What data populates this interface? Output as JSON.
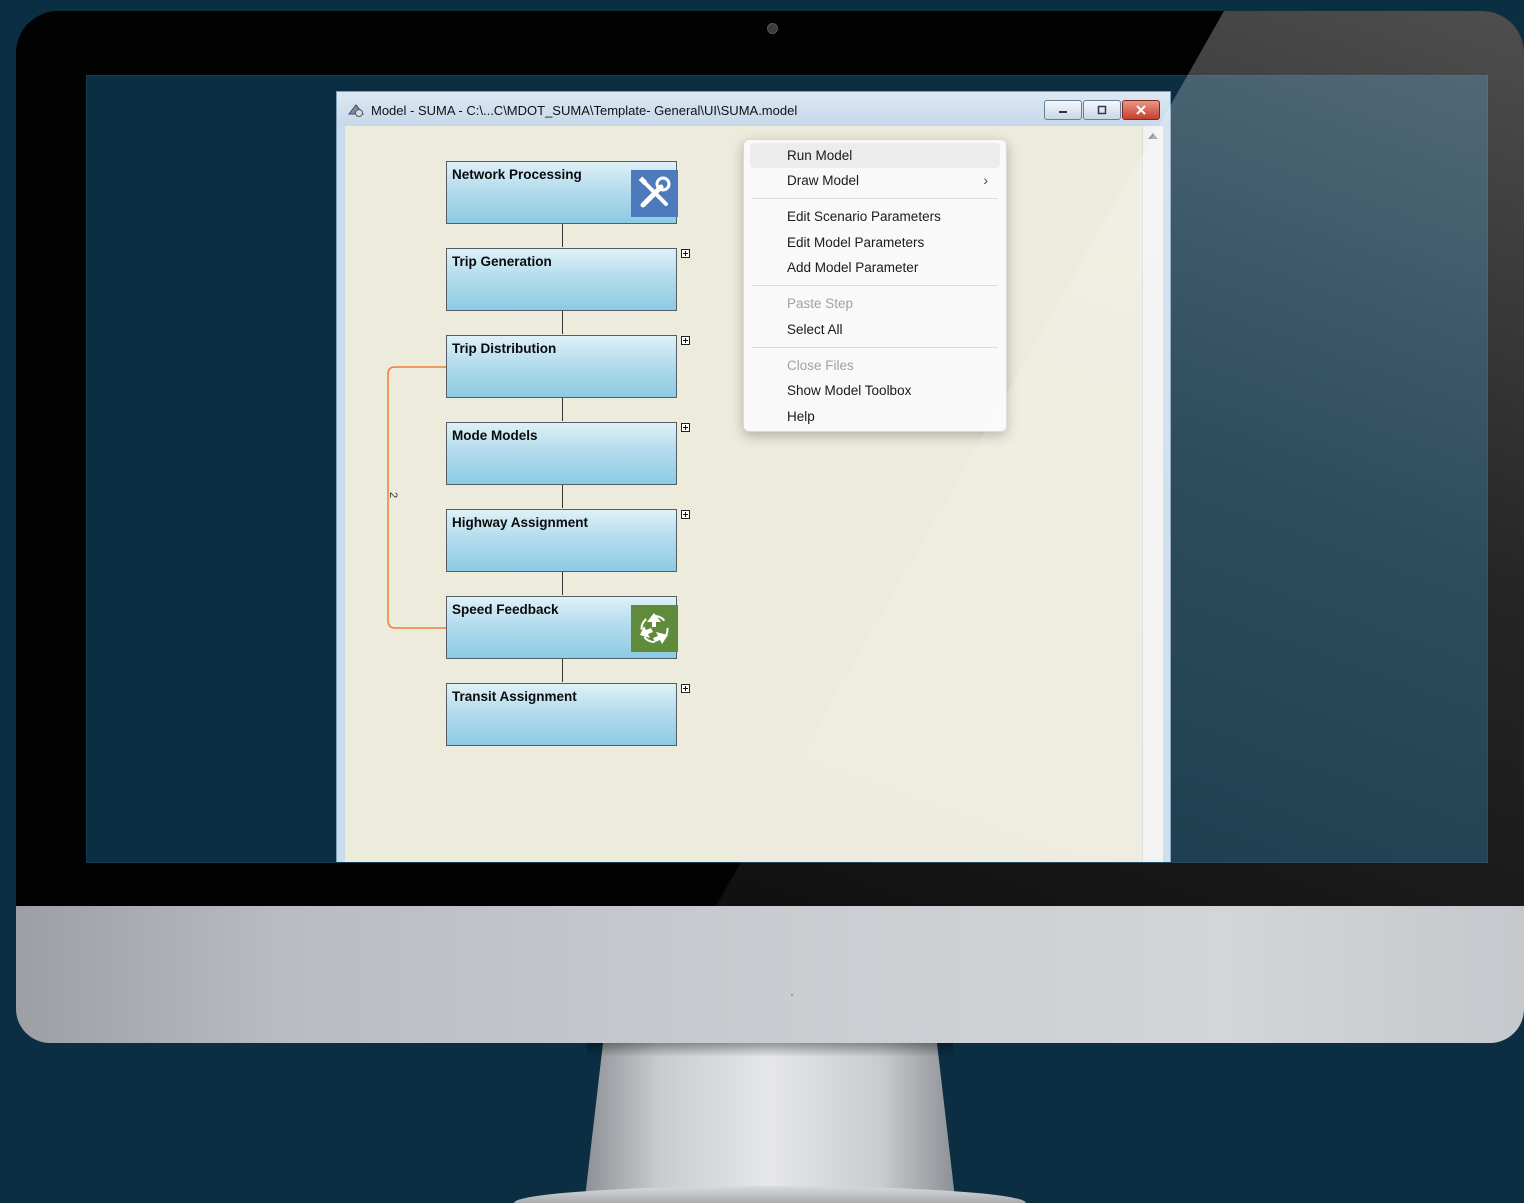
{
  "window": {
    "title": "Model - SUMA - C:\\...C\\MDOT_SUMA\\Template- General\\UI\\SUMA.model"
  },
  "model": {
    "steps": [
      {
        "label": "Network Processing",
        "icon": "tools-icon",
        "expandable": false
      },
      {
        "label": "Trip Generation",
        "expandable": true
      },
      {
        "label": "Trip Distribution",
        "expandable": true
      },
      {
        "label": "Mode Models",
        "expandable": true
      },
      {
        "label": "Highway Assignment",
        "expandable": true
      },
      {
        "label": "Speed Feedback",
        "icon": "recycle-icon",
        "expandable": false
      },
      {
        "label": "Transit Assignment",
        "expandable": true
      }
    ],
    "feedback_loop": {
      "label": "2",
      "color": "#f07c3a"
    }
  },
  "context_menu": {
    "items": [
      {
        "label": "Run Model",
        "highlighted": true
      },
      {
        "label": "Draw Model",
        "submenu": true
      },
      {
        "label": "Edit Scenario Parameters"
      },
      {
        "label": "Edit Model Parameters"
      },
      {
        "label": "Add Model Parameter"
      },
      {
        "label": "Paste Step",
        "disabled": true
      },
      {
        "label": "Select All"
      },
      {
        "label": "Close Files",
        "disabled": true
      },
      {
        "label": "Show Model Toolbox"
      },
      {
        "label": "Help"
      }
    ],
    "submenu_arrow": "›"
  },
  "colors": {
    "desktop": "#0b2e42",
    "canvas": "#ecebdc",
    "step_fill": "#8ccbe3",
    "tools_icon_bg": "#4d79bd",
    "recycle_icon_bg": "#5f8b3b",
    "close_button": "#c5402a"
  }
}
